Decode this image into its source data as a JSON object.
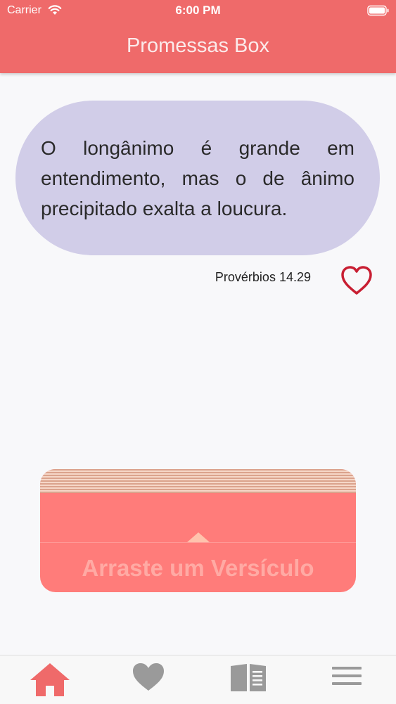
{
  "status_bar": {
    "carrier": "Carrier",
    "time": "6:00 PM",
    "icons": [
      "wifi-icon",
      "battery-icon"
    ]
  },
  "header": {
    "title": "Promessas Box",
    "background_color": "#ef6a6a"
  },
  "verse": {
    "text": "O longânimo é grande em entendimento, mas o de ânimo precipitado exalta a loucura.",
    "reference": "Provérbios 14.29",
    "bubble_color": "#d1cde8",
    "favorite_icon": "heart-outline-icon",
    "favorite_color": "#c81e32"
  },
  "drag_area": {
    "label": "Arraste um Versículo",
    "icon": "chevron-up-icon",
    "background_color": "#ff7c7a"
  },
  "tab_bar": {
    "tabs": [
      {
        "icon": "home-icon",
        "selected": true
      },
      {
        "icon": "heart-icon",
        "selected": false
      },
      {
        "icon": "book-icon",
        "selected": false
      },
      {
        "icon": "menu-icon",
        "selected": false
      }
    ],
    "active_color": "#ef6a6a",
    "inactive_color": "#9a9a9a"
  }
}
